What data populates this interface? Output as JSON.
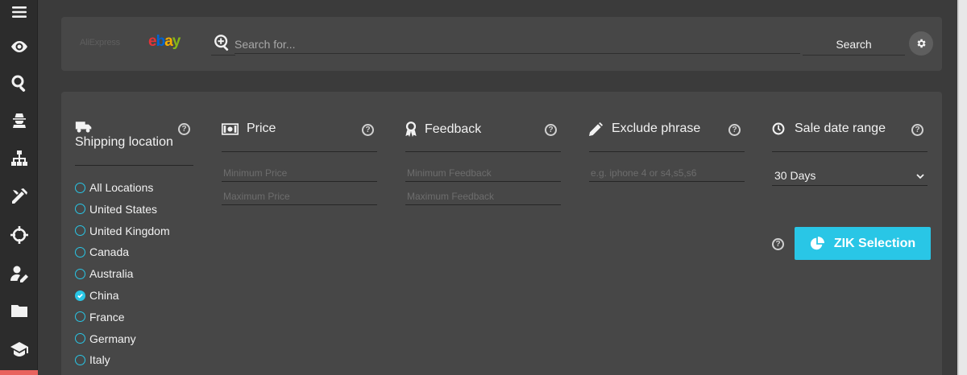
{
  "brand_logos": {
    "aliexpress": "AliExpress",
    "ebay_letters": [
      {
        "ch": "e",
        "color": "#e53238"
      },
      {
        "ch": "b",
        "color": "#0064d2"
      },
      {
        "ch": "a",
        "color": "#f5af02"
      },
      {
        "ch": "y",
        "color": "#86b817"
      }
    ]
  },
  "search": {
    "placeholder": "Search for...",
    "button_label": "Search"
  },
  "sidebar": {
    "icons": [
      "menu-icon",
      "eye-icon",
      "search-zoom-icon",
      "spy-icon",
      "sitemap-icon",
      "tools-icon",
      "crosshairs-icon",
      "user-edit-icon",
      "folder-icon",
      "graduation-cap-icon"
    ]
  },
  "filters": {
    "shipping": {
      "label": "Shipping location",
      "locations": [
        {
          "label": "All Locations",
          "checked": false
        },
        {
          "label": "United States",
          "checked": false
        },
        {
          "label": "United Kingdom",
          "checked": false
        },
        {
          "label": "Canada",
          "checked": false
        },
        {
          "label": "Australia",
          "checked": false
        },
        {
          "label": "China",
          "checked": true
        },
        {
          "label": "France",
          "checked": false
        },
        {
          "label": "Germany",
          "checked": false
        },
        {
          "label": "Italy",
          "checked": false
        }
      ]
    },
    "price": {
      "label": "Price",
      "min_placeholder": "Minimum Price",
      "max_placeholder": "Maximum Price"
    },
    "feedback": {
      "label": "Feedback",
      "min_placeholder": "Minimum Feedback",
      "max_placeholder": "Maximum Feedback"
    },
    "exclude": {
      "label": "Exclude phrase",
      "placeholder": "e.g. iphone 4 or s4,s5,s6"
    },
    "sale_date": {
      "label": "Sale date range",
      "selected": "30 Days"
    },
    "help_glyph": "?"
  },
  "zik_button": {
    "label": "ZIK Selection"
  },
  "colors": {
    "accent": "#29c6e6",
    "sidebar_active": "#e8635e",
    "panel": "#474747",
    "background": "#3b3b3b"
  }
}
